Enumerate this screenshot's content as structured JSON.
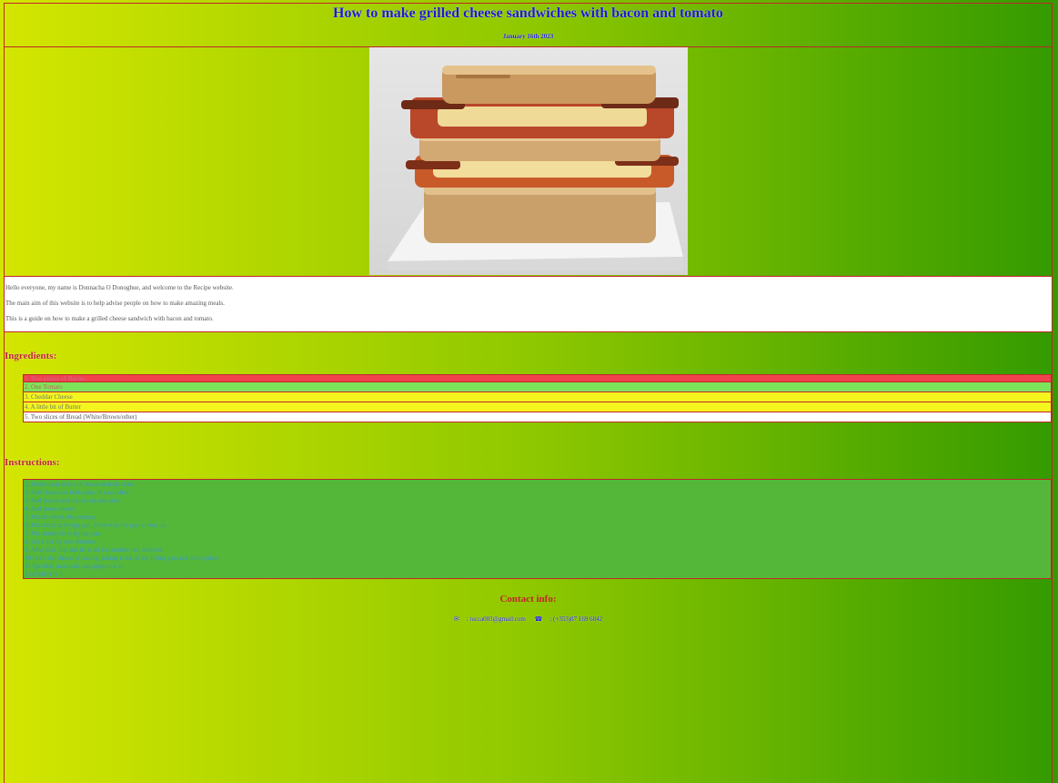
{
  "header": {
    "title": "How to make grilled cheese sandwiches with bacon and tomato",
    "date": "January 16th 2023"
  },
  "intro": {
    "lines": [
      "Hello everyone, my name is Donnacha O Donoghue, and welcome to the Recipe website.",
      "The main aim of this website is to help advise people on how to make amazing meals.",
      "This is a guide on how to make a grilled cheese sandwich with bacon and tomato."
    ]
  },
  "ingredients": {
    "heading": "Ingredients:",
    "items": [
      {
        "text": "1. Two pieces of Bacon",
        "bg": "#f0434d",
        "color": "#c96a9a"
      },
      {
        "text": "2. One Tomato",
        "bg": "#7ce45a",
        "color": "#cc5a5a"
      },
      {
        "text": "3. Cheddar Cheese",
        "bg": "#f5f51e",
        "color": "#6a7a6a"
      },
      {
        "text": "4. A little bit of Butter",
        "bg": "#f5f51e",
        "color": "#6a7a6a"
      },
      {
        "text": "5. Two slices of Bread (White/Brown/other)",
        "bg": "#ffffff",
        "color": "#555555"
      }
    ]
  },
  "instructions": {
    "heading": "Instructions:",
    "steps": [
      "1. Butter your slices of bread on both sides.",
      "2. Add cheese on both sides of each slice.",
      "3. Add bacon and tomato on one slice.",
      "4. Add more cheese.",
      "5. Put the other slice on top.",
      "6. Put butter in frying pan. Then wait for pan to heat up.",
      "7. Put sandwich in frying pan.",
      "8. Let it set for two minutes.",
      "9. After that, flip and let it set for another two minutes.",
      "10.Once the cheese is oozing, taking it out of the frying pan and onto a plate.",
      "11.Sprinkle some salt and pepper on it.",
      "12.ENJOY!! :)"
    ]
  },
  "contact": {
    "heading": "Contact info:",
    "email_icon": "envelope-icon",
    "email": ": tucca003@gmail.com",
    "phone_icon": "phone-icon",
    "phone": ": (+353)87 169 6842"
  }
}
